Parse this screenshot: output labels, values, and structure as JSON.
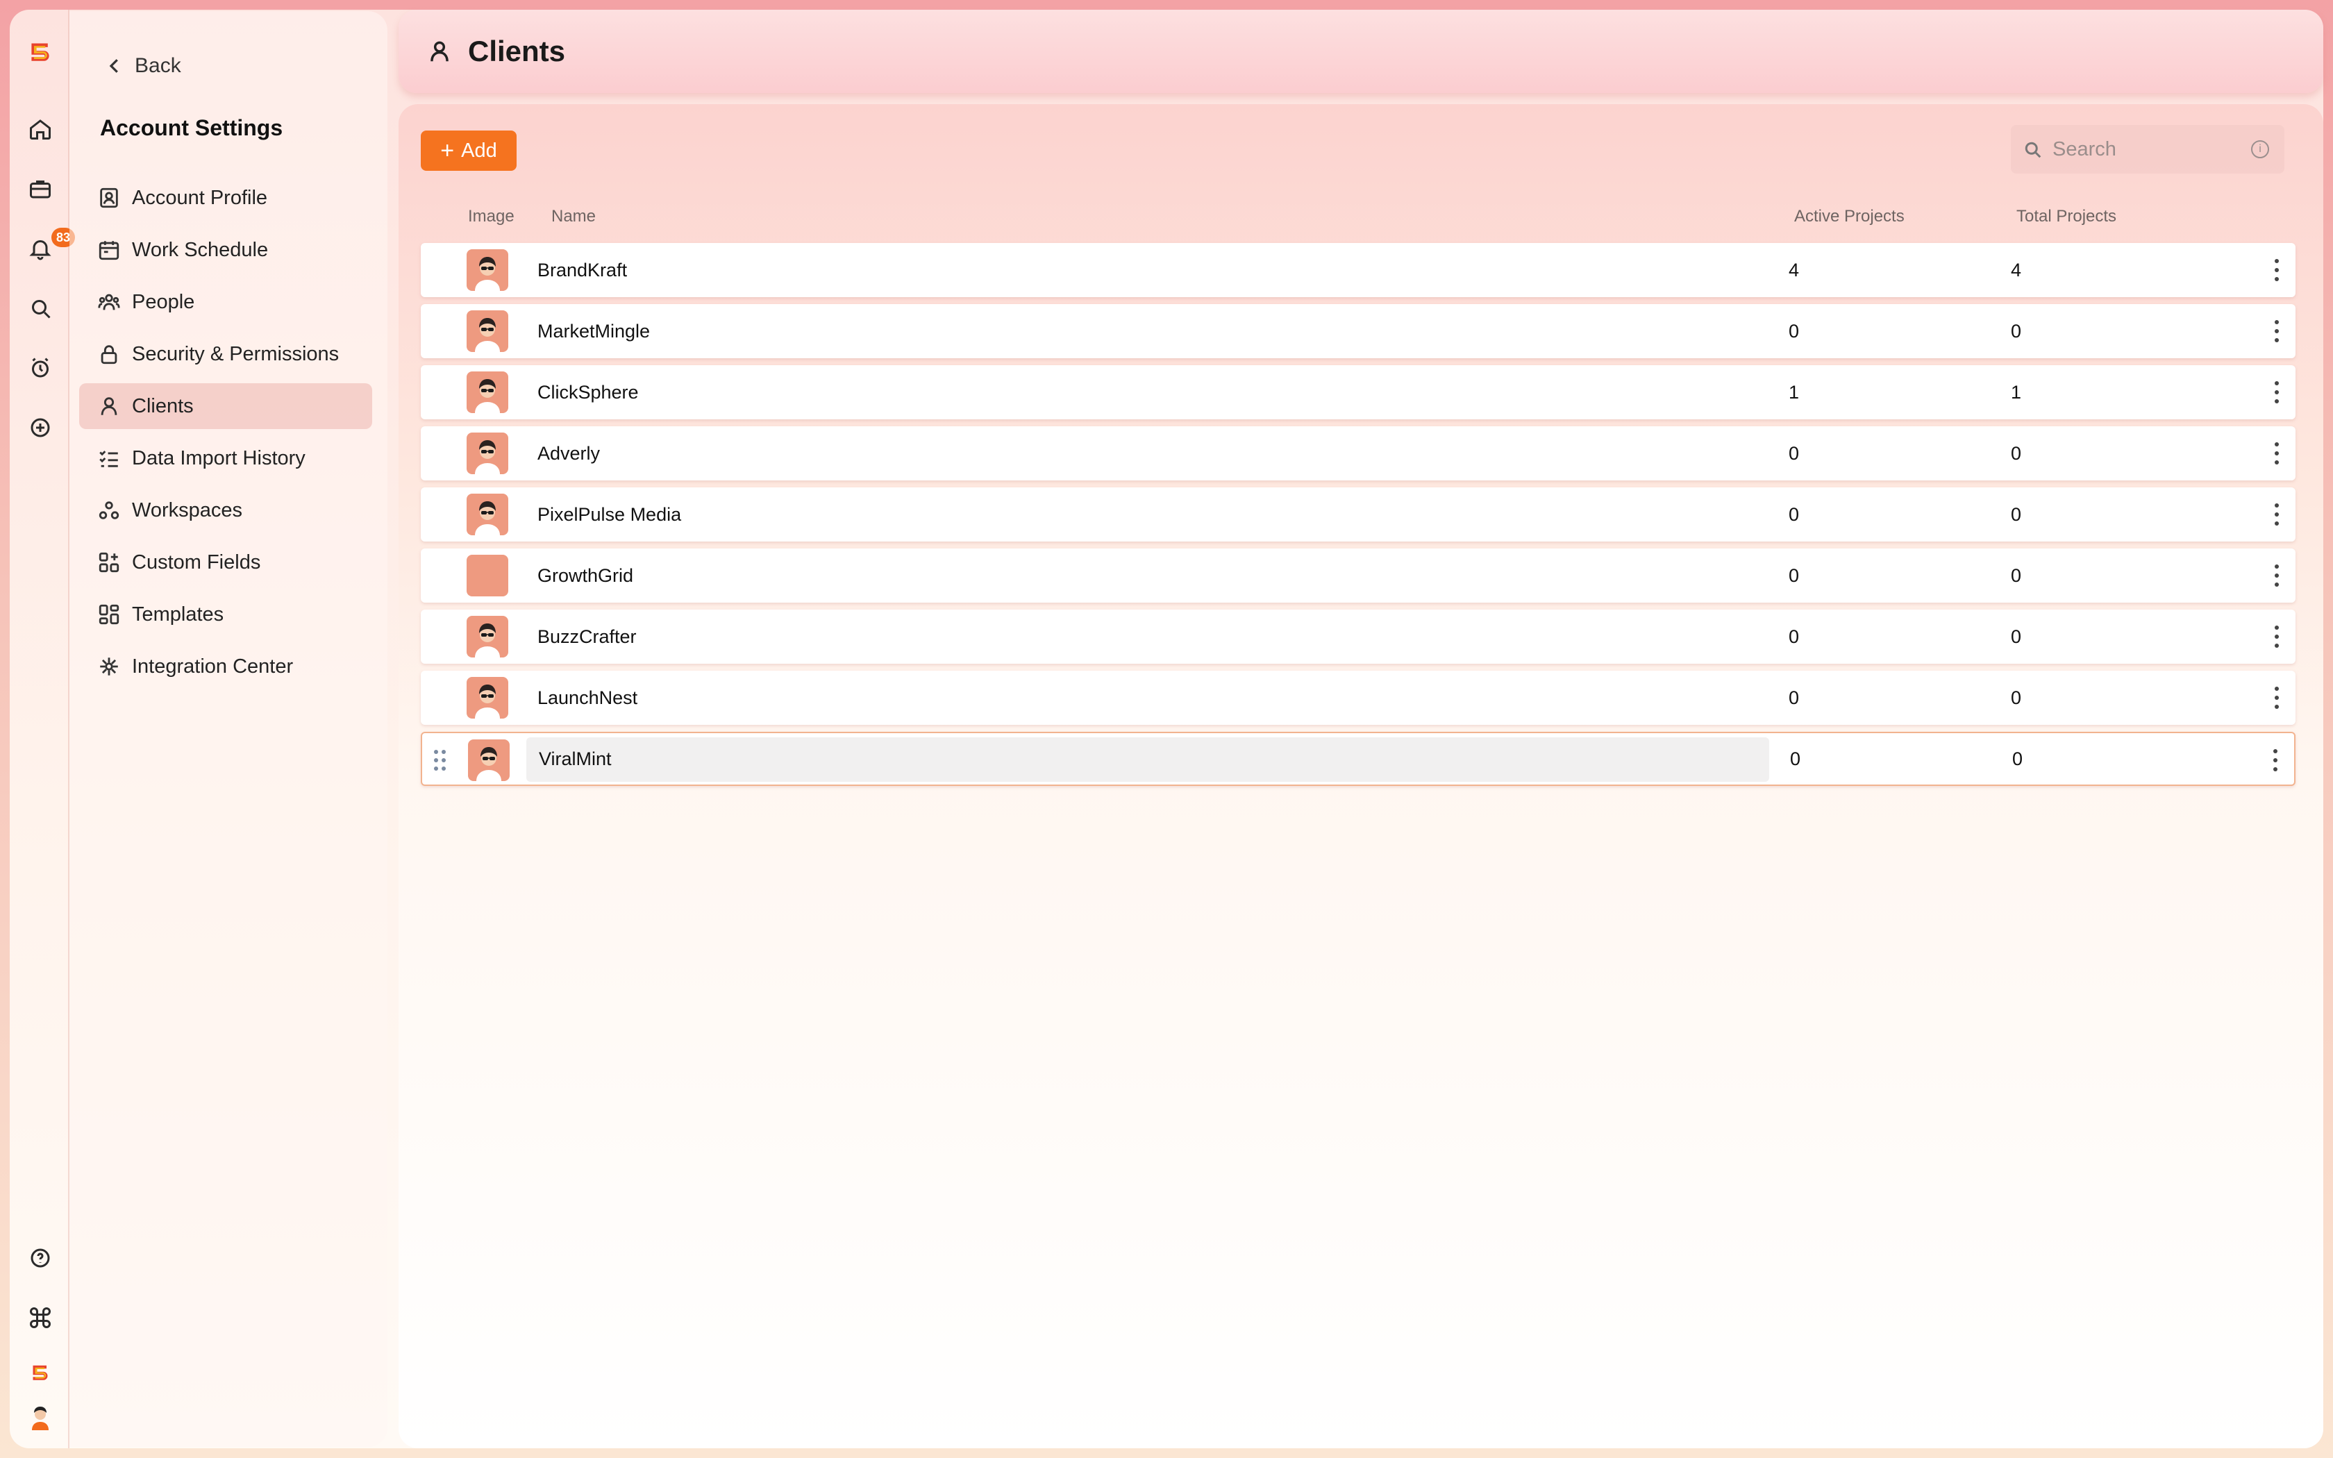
{
  "app": {
    "nav_icons": [
      "logo-icon",
      "home-icon",
      "briefcase-icon",
      "bell-icon",
      "search-icon",
      "timer-icon",
      "plus-circle-icon"
    ],
    "notification_count": "83",
    "bottom_icons": [
      "help-icon",
      "command-icon",
      "logo-small-icon",
      "user-avatar-icon"
    ]
  },
  "sidebar": {
    "back_label": "Back",
    "title": "Account Settings",
    "items": [
      {
        "label": "Account Profile",
        "icon": "profile-card-icon"
      },
      {
        "label": "Work Schedule",
        "icon": "calendar-icon"
      },
      {
        "label": "People",
        "icon": "people-icon"
      },
      {
        "label": "Security & Permissions",
        "icon": "lock-icon"
      },
      {
        "label": "Clients",
        "icon": "client-icon",
        "active": true
      },
      {
        "label": "Data Import History",
        "icon": "checklist-icon"
      },
      {
        "label": "Workspaces",
        "icon": "workspaces-icon"
      },
      {
        "label": "Custom Fields",
        "icon": "custom-fields-icon"
      },
      {
        "label": "Templates",
        "icon": "templates-icon"
      },
      {
        "label": "Integration Center",
        "icon": "integration-icon"
      }
    ]
  },
  "header": {
    "title": "Clients"
  },
  "toolbar": {
    "add_label": "Add",
    "search_placeholder": "Search"
  },
  "table": {
    "columns": {
      "image": "Image",
      "name": "Name",
      "active": "Active Projects",
      "total": "Total Projects"
    },
    "rows": [
      {
        "name": "BrandKraft",
        "active": "4",
        "total": "4",
        "has_image": true
      },
      {
        "name": "MarketMingle",
        "active": "0",
        "total": "0",
        "has_image": true
      },
      {
        "name": "ClickSphere",
        "active": "1",
        "total": "1",
        "has_image": true
      },
      {
        "name": "Adverly",
        "active": "0",
        "total": "0",
        "has_image": true
      },
      {
        "name": "PixelPulse Media",
        "active": "0",
        "total": "0",
        "has_image": true
      },
      {
        "name": "GrowthGrid",
        "active": "0",
        "total": "0",
        "has_image": false
      },
      {
        "name": "BuzzCrafter",
        "active": "0",
        "total": "0",
        "has_image": true
      },
      {
        "name": "LaunchNest",
        "active": "0",
        "total": "0",
        "has_image": true
      },
      {
        "name": "ViralMint",
        "active": "0",
        "total": "0",
        "has_image": true,
        "selected": true
      }
    ]
  },
  "colors": {
    "accent": "#f5731f",
    "avatar_bg": "#ee9a80",
    "badge": "#f26b1d"
  }
}
